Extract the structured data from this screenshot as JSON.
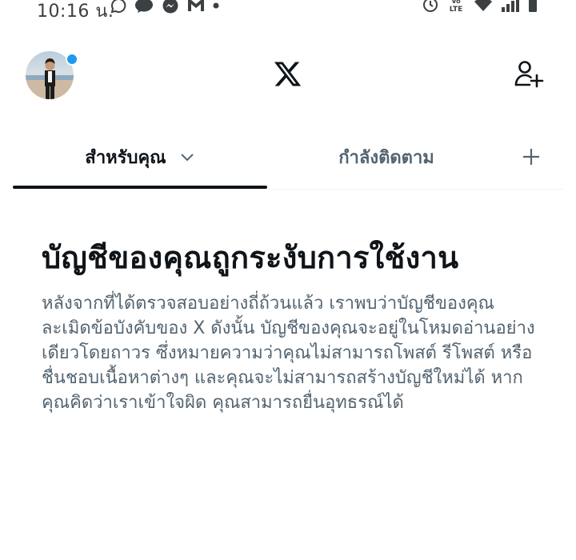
{
  "status_bar": {
    "time": "10:16 น.",
    "left_icons": [
      "chat-bubble-icon",
      "message-icon",
      "messenger-icon",
      "gmail-icon",
      "dot-icon"
    ],
    "right_icons": [
      "alarm-icon",
      "volte-icon",
      "wifi-icon",
      "signal-icon",
      "battery-icon"
    ],
    "volte_label": "VoLTE"
  },
  "header": {
    "avatar_icon": "profile-avatar",
    "logo_icon": "x-logo-icon",
    "follow_icon": "add-user-icon",
    "notification_color": "#1d9bf0"
  },
  "tabs": {
    "items": [
      {
        "label": "สำหรับคุณ",
        "active": true
      },
      {
        "label": "กำลังติดตาม",
        "active": false
      }
    ],
    "add_icon": "plus-icon"
  },
  "notice": {
    "title": "บัญชีของคุณถูกระงับการใช้งาน",
    "body": "หลังจากที่ได้ตรวจสอบอย่างถี่ถ้วนแล้ว เราพบว่าบัญชีของคุณละเมิดข้อบังคับของ X ดังนั้น บัญชีของคุณจะอยู่ในโหมดอ่านอย่างเดียวโดยถาวร ซึ่งหมายความว่าคุณไม่สามารถโพสต์ รีโพสต์ หรือชื่นชอบเนื้อหาต่างๆ และคุณจะไม่สามารถสร้างบัญชีใหม่ได้ หากคุณคิดว่าเราเข้าใจผิด คุณสามารถยื่นอุทธรณ์ได้"
  },
  "colors": {
    "text_primary": "#0f1419",
    "text_secondary": "#536471",
    "accent": "#1d9bf0",
    "divider": "#eff3f4"
  }
}
